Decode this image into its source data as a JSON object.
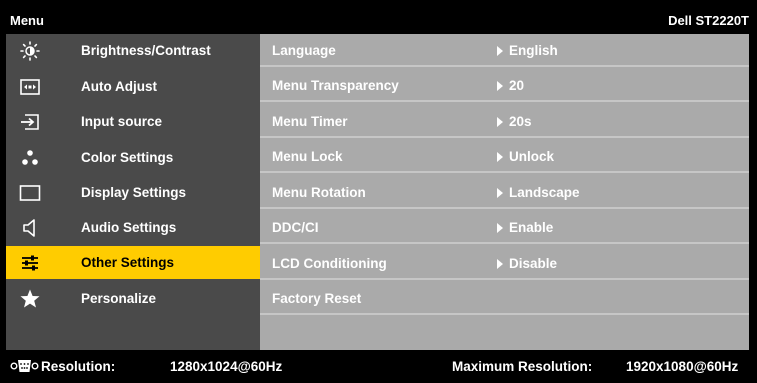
{
  "header": {
    "title": "Menu",
    "model": "Dell ST2220T"
  },
  "sidebar": {
    "items": [
      {
        "label": "Brightness/Contrast",
        "icon": "brightness-icon",
        "active": false
      },
      {
        "label": "Auto Adjust",
        "icon": "auto-adjust-icon",
        "active": false
      },
      {
        "label": "Input source",
        "icon": "input-source-icon",
        "active": false
      },
      {
        "label": "Color Settings",
        "icon": "color-settings-icon",
        "active": false
      },
      {
        "label": "Display Settings",
        "icon": "display-settings-icon",
        "active": false
      },
      {
        "label": "Audio Settings",
        "icon": "speaker-icon",
        "active": false
      },
      {
        "label": "Other Settings",
        "icon": "other-settings-icon",
        "active": true
      },
      {
        "label": "Personalize",
        "icon": "star-icon",
        "active": false
      }
    ]
  },
  "settings": {
    "rows": [
      {
        "name": "Language",
        "value": "English"
      },
      {
        "name": "Menu Transparency",
        "value": "20"
      },
      {
        "name": "Menu Timer",
        "value": "20s"
      },
      {
        "name": "Menu Lock",
        "value": "Unlock"
      },
      {
        "name": "Menu Rotation",
        "value": "Landscape"
      },
      {
        "name": "DDC/CI",
        "value": "Enable"
      },
      {
        "name": "LCD Conditioning",
        "value": "Disable"
      },
      {
        "name": "Factory Reset",
        "value": ""
      }
    ]
  },
  "footer": {
    "resolution_label": "Resolution:",
    "resolution_value": "1280x1024@60Hz",
    "max_label": "Maximum Resolution:",
    "max_value": "1920x1080@60Hz",
    "connector_icon": "vga-connector-icon"
  },
  "colors": {
    "background": "#000000",
    "sidebar": "#4a4a4a",
    "content": "#aaaaaa",
    "highlight": "#ffcc00"
  }
}
